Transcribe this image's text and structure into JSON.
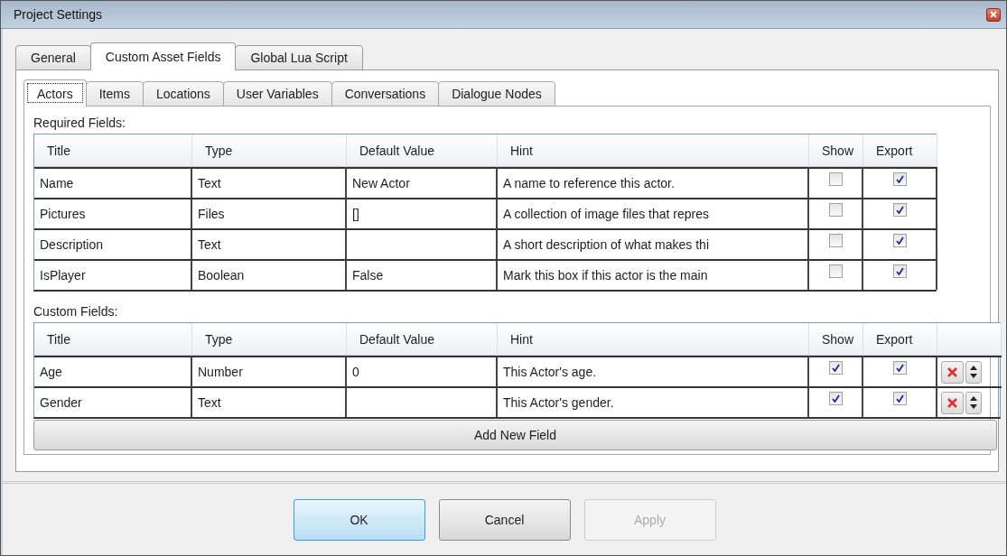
{
  "window": {
    "title": "Project Settings"
  },
  "tabs": [
    {
      "label": "General",
      "selected": false
    },
    {
      "label": "Custom Asset Fields",
      "selected": true
    },
    {
      "label": "Global Lua Script",
      "selected": false
    }
  ],
  "subtabs": [
    {
      "label": "Actors",
      "selected": true
    },
    {
      "label": "Items",
      "selected": false
    },
    {
      "label": "Locations",
      "selected": false
    },
    {
      "label": "User Variables",
      "selected": false
    },
    {
      "label": "Conversations",
      "selected": false
    },
    {
      "label": "Dialogue Nodes",
      "selected": false
    }
  ],
  "required_fields": {
    "label": "Required Fields:",
    "columns": [
      "Title",
      "Type",
      "Default Value",
      "Hint",
      "Show",
      "Export"
    ],
    "rows": [
      {
        "title": "Name",
        "type": "Text",
        "default_value": "New Actor",
        "hint": "A name to reference this actor.",
        "show": false,
        "export": true
      },
      {
        "title": "Pictures",
        "type": "Files",
        "default_value": "[]",
        "hint": "A collection of image files that repres",
        "show": false,
        "export": true
      },
      {
        "title": "Description",
        "type": "Text",
        "default_value": "",
        "hint": "A short description of what makes thi",
        "show": false,
        "export": true
      },
      {
        "title": "IsPlayer",
        "type": "Boolean",
        "default_value": "False",
        "hint": "Mark this box if this actor is the main",
        "show": false,
        "export": true
      }
    ]
  },
  "custom_fields": {
    "label": "Custom Fields:",
    "columns": [
      "Title",
      "Type",
      "Default Value",
      "Hint",
      "Show",
      "Export"
    ],
    "rows": [
      {
        "title": "Age",
        "type": "Number",
        "default_value": "0",
        "hint": "This Actor's age.",
        "show": true,
        "export": true
      },
      {
        "title": "Gender",
        "type": "Text",
        "default_value": "",
        "hint": "This Actor's gender.",
        "show": true,
        "export": true
      }
    ],
    "add_button": "Add New Field"
  },
  "buttons": [
    {
      "label": "OK",
      "default": true,
      "disabled": false
    },
    {
      "label": "Cancel",
      "default": false,
      "disabled": false
    },
    {
      "label": "Apply",
      "default": false,
      "disabled": true
    }
  ]
}
